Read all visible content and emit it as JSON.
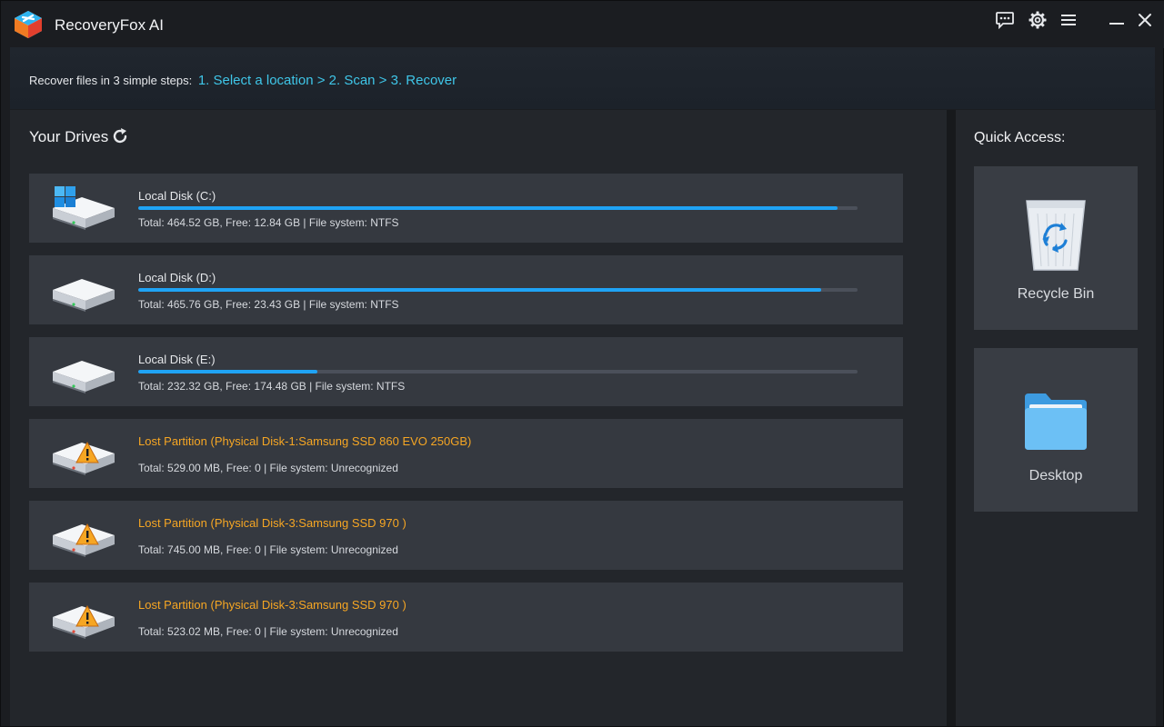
{
  "app": {
    "title": "RecoveryFox AI"
  },
  "titlebar": {
    "icons": [
      "feedback-icon",
      "settings-icon",
      "menu-icon",
      "minimize-icon",
      "close-icon"
    ]
  },
  "steps": {
    "prefix": "Recover files in 3 simple steps:",
    "link": "1. Select a location > 2. Scan > 3. Recover"
  },
  "drives": {
    "header": "Your Drives",
    "items": [
      {
        "name": "Local Disk (C:)",
        "info": "Total: 464.52 GB, Free: 12.84 GB | File system: NTFS",
        "used_fraction": 0.9724,
        "type": "windows",
        "lost": false
      },
      {
        "name": "Local Disk (D:)",
        "info": "Total: 465.76 GB, Free: 23.43 GB | File system: NTFS",
        "used_fraction": 0.9497,
        "type": "disk",
        "lost": false
      },
      {
        "name": "Local Disk (E:)",
        "info": "Total: 232.32 GB, Free: 174.48 GB | File system: NTFS",
        "used_fraction": 0.249,
        "type": "disk",
        "lost": false
      },
      {
        "name": "Lost Partition (Physical Disk-1:Samsung SSD 860 EVO 250GB)",
        "info": "Total: 529.00 MB, Free: 0 | File system: Unrecognized",
        "used_fraction": null,
        "type": "lost",
        "lost": true
      },
      {
        "name": "Lost Partition (Physical Disk-3:Samsung SSD 970 )",
        "info": "Total: 745.00 MB, Free: 0 | File system: Unrecognized",
        "used_fraction": null,
        "type": "lost",
        "lost": true
      },
      {
        "name": "Lost Partition (Physical Disk-3:Samsung SSD 970 )",
        "info": "Total: 523.02 MB, Free: 0 | File system: Unrecognized",
        "used_fraction": null,
        "type": "lost",
        "lost": true
      }
    ]
  },
  "quick_access": {
    "title": "Quick Access:",
    "items": [
      {
        "label": "Recycle Bin",
        "icon": "recycle-bin-icon"
      },
      {
        "label": "Desktop",
        "icon": "folder-icon"
      }
    ]
  },
  "colors": {
    "accent": "#1fa3f5",
    "link": "#3fc6e8",
    "warning": "#f6a623",
    "background": "#1b1d21",
    "panel": "#23262b",
    "row": "#353940"
  }
}
